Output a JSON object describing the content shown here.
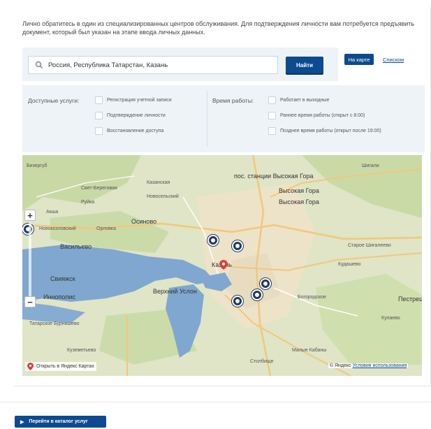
{
  "intro_text": "Лично обратитесь в один из специализированных центров обслуживания. Для подтверждения личности вам потребуется предъявить документ, который был указан на этапе ввода личных данных.",
  "search": {
    "value": "Россия, Республика Татарстан, Казань",
    "find_label": "Найти"
  },
  "view_toggle": {
    "map_label": "На карте",
    "list_label": "Списком"
  },
  "filters": {
    "services_title": "Доступные услуги:",
    "services": [
      "Регистрация учетной записи",
      "Подтверждение личности",
      "Восстановление доступа"
    ],
    "hours_title": "Время работы:",
    "hours": [
      "Работает в выходные",
      "Раннее время работы (открыт с 8:00)",
      "Позднее время работы (открыт после 19:00)"
    ]
  },
  "map": {
    "labels": {
      "biyserguyb": "Бизергуб",
      "svet_beregovaya": "Свет-Береговая",
      "kazanskaya": "Казанская",
      "rujka": "Руйка",
      "novoselskiy": "Новосельский",
      "osinovo": "Осиново",
      "aksha": "Акша",
      "novokazanskiy": "Новокозловский",
      "orlovo": "Орловка",
      "vasilevo": "Васильево",
      "sviyazhsk": "Свияжск",
      "innopolis": "Иннополис",
      "verhniy_uslon": "Верхний Услон",
      "kazan": "Казань",
      "vysokaya_gora1": "пос. станции Высокая Гора",
      "vysokaya_gora2": "Высокая Гора",
      "vysokaya_gora3": "Высокая Гора",
      "shinyaz": "Шигали",
      "staroe_shigalevo": "Старое Шигалеево",
      "kudashevo": "Кудашево",
      "pestrecy": "Пестрецы",
      "kulaevo": "Кулаево",
      "bogorodskoe": "Богородское",
      "tatarskoe_burnashevo": "Татарское Бурнашево",
      "malye_kabany": "Малые Кабаны",
      "stolbishche": "Столбище",
      "kirelay": "Куземетьево"
    },
    "open_yandex": "Открыть в Яндекс Картах",
    "copyright": "© Яндекс",
    "terms": "Условия использования"
  },
  "catalog_button": "Перейти в каталог услуг"
}
